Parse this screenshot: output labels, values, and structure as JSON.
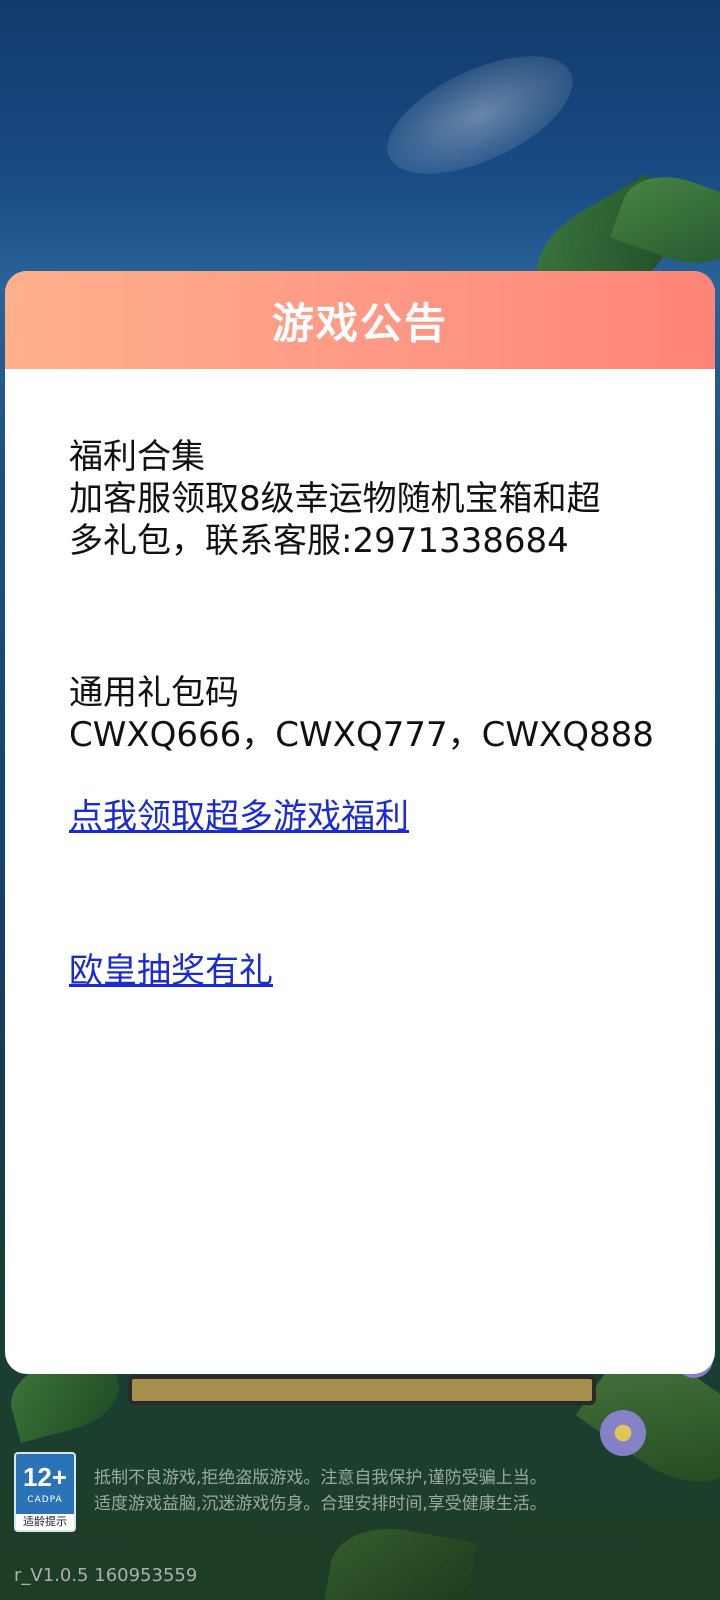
{
  "modal": {
    "title": "游戏公告",
    "welfare_heading": "福利合集",
    "welfare_line1": "加客服领取8级幸运物随机宝箱和超",
    "welfare_line2": "多礼包，联系客服:2971338684",
    "code_heading": "通用礼包码",
    "codes": "CWXQ666，CWXQ777，CWXQ888",
    "link_welfare": "点我领取超多游戏福利",
    "link_lottery": "欧皇抽奖有礼"
  },
  "footer": {
    "age_rating": "12+",
    "age_org": "CADPA",
    "age_tip": "适龄提示",
    "notice_line1": "抵制不良游戏,拒绝盗版游戏。注意自我保护,谨防受骗上当。",
    "notice_line2": "适度游戏益脑,沉迷游戏伤身。合理安排时间,享受健康生活。",
    "version": "r_V1.0.5  160953559"
  },
  "colors": {
    "header_gradient_start": "#ffb08a",
    "header_gradient_end": "#ff8477",
    "link": "#1a2bd6",
    "age_badge": "#2a73b8"
  }
}
